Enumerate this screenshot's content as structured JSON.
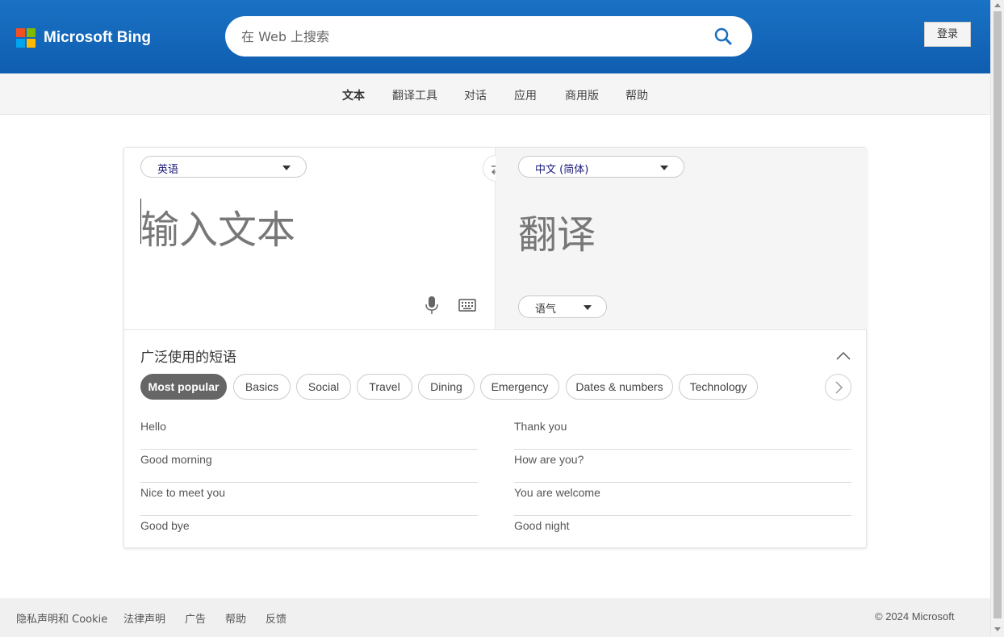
{
  "header": {
    "brand": "Microsoft Bing",
    "logo_colors": [
      "#f25022",
      "#7fba00",
      "#00a4ef",
      "#ffb900"
    ],
    "search_placeholder": "在 Web 上搜索",
    "login_label": "登录"
  },
  "nav": {
    "items": [
      {
        "label": "文本",
        "active": true
      },
      {
        "label": "翻译工具",
        "active": false
      },
      {
        "label": "对话",
        "active": false
      },
      {
        "label": "应用",
        "active": false
      },
      {
        "label": "商用版",
        "active": false
      },
      {
        "label": "帮助",
        "active": false
      }
    ]
  },
  "translator": {
    "source_lang": "英语",
    "target_lang": "中文 (简体)",
    "source_placeholder": "输入文本",
    "target_placeholder": "翻译",
    "tone_label": "语气"
  },
  "phrases": {
    "title": "广泛使用的短语",
    "categories": [
      {
        "label": "Most popular",
        "active": true
      },
      {
        "label": "Basics",
        "active": false
      },
      {
        "label": "Social",
        "active": false
      },
      {
        "label": "Travel",
        "active": false
      },
      {
        "label": "Dining",
        "active": false
      },
      {
        "label": "Emergency",
        "active": false
      },
      {
        "label": "Dates & numbers",
        "active": false
      },
      {
        "label": "Technology",
        "active": false
      }
    ],
    "left": [
      "Hello",
      "Good morning",
      "Nice to meet you",
      "Good bye"
    ],
    "right": [
      "Thank you",
      "How are you?",
      "You are welcome",
      "Good night"
    ]
  },
  "footer": {
    "links": [
      "隐私声明和 Cookie",
      "法律声明",
      "广告",
      "帮助",
      "反馈"
    ],
    "copyright": "© 2024 Microsoft"
  }
}
